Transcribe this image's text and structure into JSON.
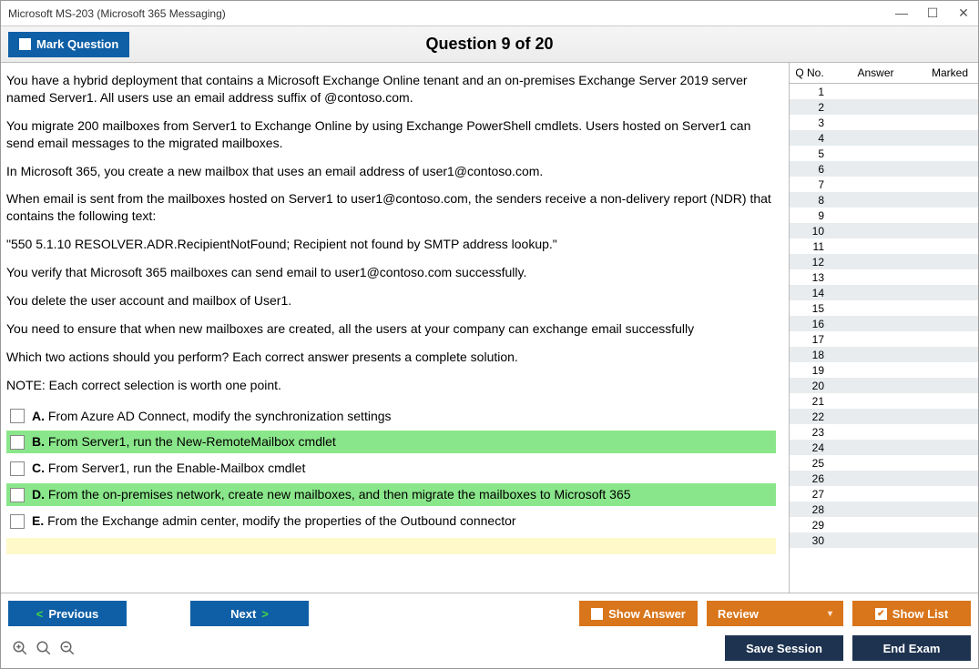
{
  "window": {
    "title": "Microsoft MS-203 (Microsoft 365 Messaging)"
  },
  "toolbar": {
    "mark_label": "Mark Question",
    "question_label": "Question 9 of 20"
  },
  "question": {
    "paragraphs": [
      "You have a hybrid deployment that contains a Microsoft Exchange Online tenant and an on-premises Exchange Server 2019 server named Server1. All users use an email address suffix of @contoso.com.",
      "You migrate 200 mailboxes from Server1 to Exchange Online by using Exchange PowerShell cmdlets. Users hosted on Server1 can send email messages to the migrated mailboxes.",
      "In Microsoft 365, you create a new mailbox that uses an email address of user1@contoso.com.",
      "When email is sent from the mailboxes hosted on Server1 to user1@contoso.com, the senders receive a non-delivery report (NDR) that contains the following text:",
      "\"550 5.1.10 RESOLVER.ADR.RecipientNotFound; Recipient not found by SMTP address lookup.\"",
      "You verify that Microsoft 365 mailboxes can send email to user1@contoso.com successfully.",
      "You delete the user account and mailbox of User1.",
      "You need to ensure that when new mailboxes are created, all the users at your company can exchange email successfully",
      "Which two actions should you perform? Each correct answer presents a complete solution.",
      "NOTE: Each correct selection is worth one point."
    ],
    "options": [
      {
        "letter": "A.",
        "text": "From Azure AD Connect, modify the synchronization settings",
        "correct": false
      },
      {
        "letter": "B.",
        "text": "From Server1, run the New-RemoteMailbox cmdlet",
        "correct": true
      },
      {
        "letter": "C.",
        "text": "From Server1, run the Enable-Mailbox cmdlet",
        "correct": false
      },
      {
        "letter": "D.",
        "text": "From the on-premises network, create new mailboxes, and then migrate the mailboxes to Microsoft 365",
        "correct": true
      },
      {
        "letter": "E.",
        "text": "From the Exchange admin center, modify the properties of the Outbound connector",
        "correct": false
      }
    ]
  },
  "side": {
    "headers": {
      "qno": "Q No.",
      "answer": "Answer",
      "marked": "Marked"
    },
    "count": 30
  },
  "buttons": {
    "previous": "Previous",
    "next": "Next",
    "show_answer": "Show Answer",
    "review": "Review",
    "show_list": "Show List",
    "save_session": "Save Session",
    "end_exam": "End Exam"
  }
}
